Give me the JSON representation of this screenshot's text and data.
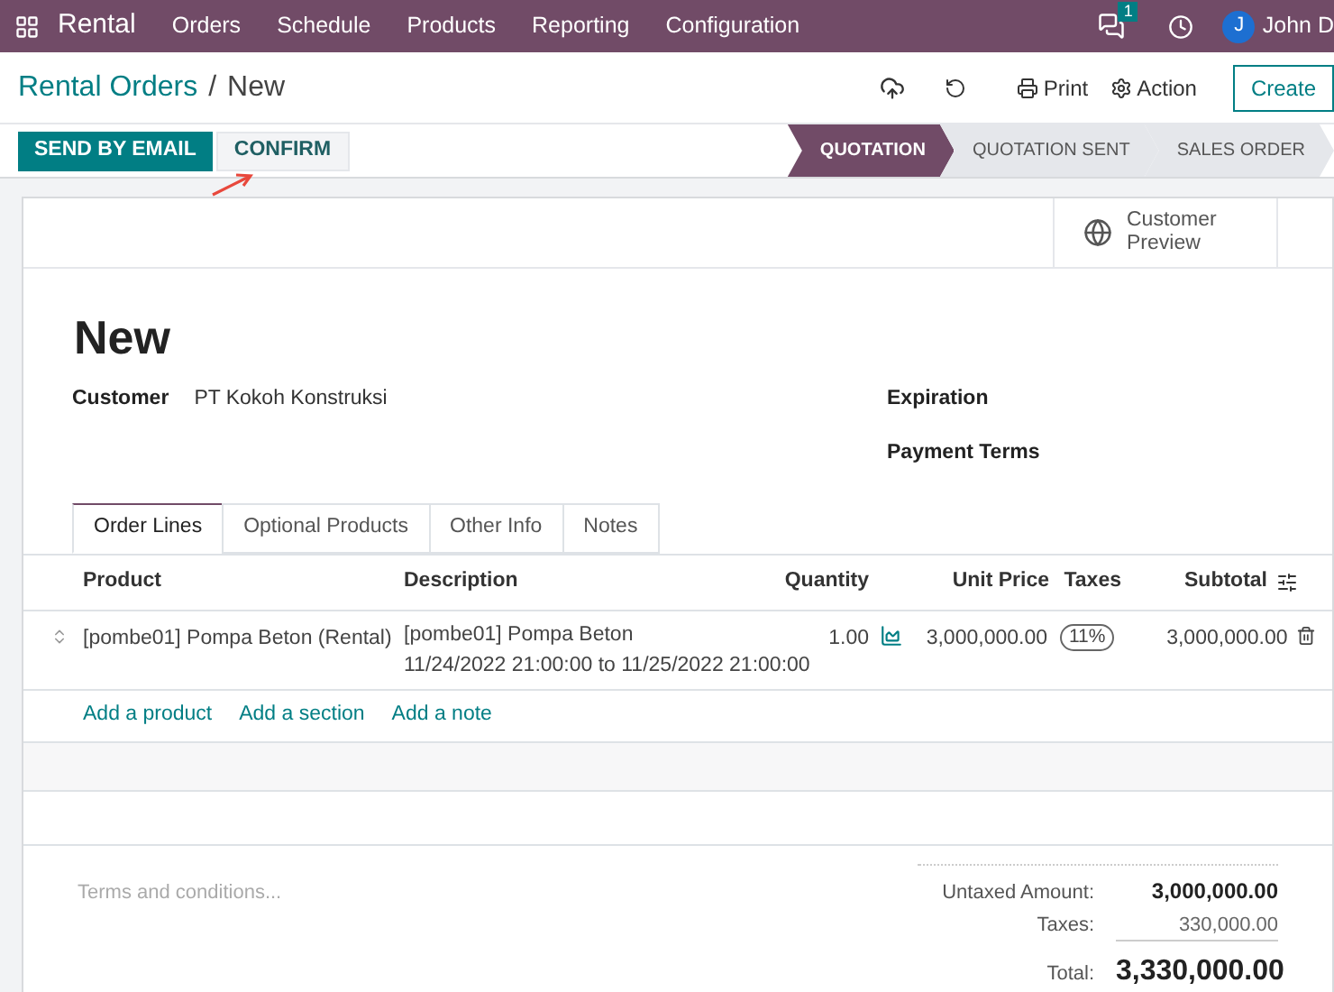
{
  "navbar": {
    "app_name": "Rental",
    "menu": [
      "Orders",
      "Schedule",
      "Products",
      "Reporting",
      "Configuration"
    ],
    "message_count": "1",
    "user_initial": "J",
    "user_name": "John D"
  },
  "control_panel": {
    "breadcrumb": "Rental Orders",
    "separator": "/",
    "current": "New",
    "print": "Print",
    "action": "Action",
    "create": "Create"
  },
  "buttons": [
    {
      "label": "SEND BY EMAIL",
      "kind": "primary"
    },
    {
      "label": "CONFIRM",
      "kind": "secondary"
    }
  ],
  "stages": [
    {
      "label": "QUOTATION",
      "selected": true
    },
    {
      "label": "QUOTATION SENT",
      "selected": false
    },
    {
      "label": "SALES ORDER",
      "selected": false
    }
  ],
  "smart_button": {
    "line1": "Customer",
    "line2": "Preview"
  },
  "title": "New",
  "fields_left": [
    {
      "label": "Customer",
      "value": "PT Kokoh Konstruksi"
    }
  ],
  "fields_right": [
    {
      "label": "Expiration"
    },
    {
      "label": "Payment Terms"
    }
  ],
  "tabs": [
    {
      "label": "Order Lines",
      "selected": true
    },
    {
      "label": "Optional Products",
      "selected": false
    },
    {
      "label": "Other Info",
      "selected": false
    },
    {
      "label": "Notes",
      "selected": false
    }
  ],
  "table": {
    "columns": [
      "Product",
      "Description",
      "Quantity",
      "Unit Price",
      "Taxes",
      "Subtotal"
    ],
    "rows": [
      {
        "product": "[pombe01] Pompa Beton (Rental)",
        "description": [
          "[pombe01] Pompa Beton",
          "11/24/2022 21:00:00 to 11/25/2022 21:00:00"
        ],
        "quantity": "1.00",
        "unit_price": "3,000,000.00",
        "tax": "11%",
        "subtotal": "3,000,000.00"
      }
    ],
    "add_links": [
      "Add a product",
      "Add a section",
      "Add a note"
    ]
  },
  "terms": {
    "placeholder": "Terms and conditions..."
  },
  "totals": [
    {
      "label": "Untaxed Amount:",
      "value": "3,000,000.00",
      "kind": "untaxed"
    },
    {
      "label": "Taxes:",
      "value": "330,000.00",
      "kind": "tax"
    },
    {
      "label": "Total:",
      "value": "3,330,000.00",
      "kind": "total"
    }
  ]
}
